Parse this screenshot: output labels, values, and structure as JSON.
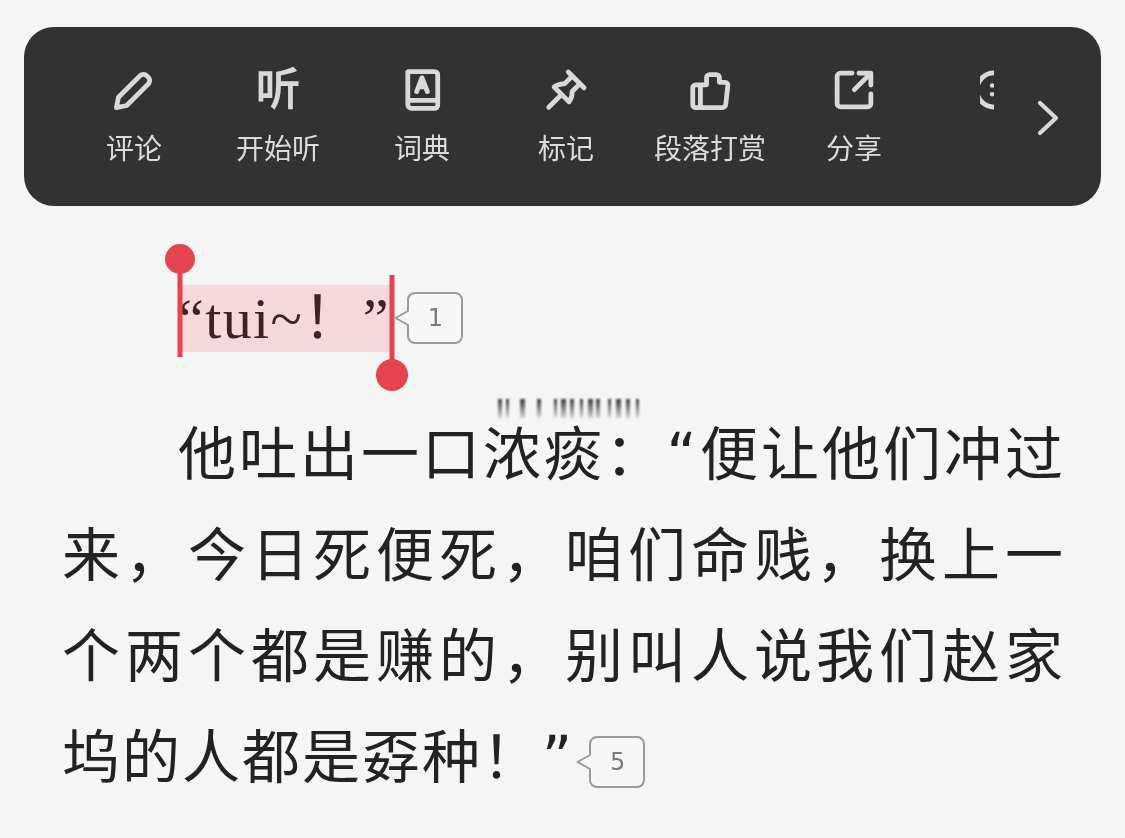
{
  "toolbar": {
    "items": [
      {
        "kind": "icon",
        "label": "评论"
      },
      {
        "kind": "glyph",
        "glyph": "听",
        "label": "开始听"
      },
      {
        "kind": "icon",
        "label": "词典"
      },
      {
        "kind": "icon",
        "label": "标记"
      },
      {
        "kind": "icon",
        "label": "段落打赏"
      },
      {
        "kind": "icon",
        "label": "分享"
      },
      {
        "kind": "partial"
      }
    ]
  },
  "selection": {
    "text": "“tui~！”",
    "badge": "1"
  },
  "paragraph": {
    "text": "他吐出一口浓痰：“便让他们冲过来，今日死便死，咱们命贱，换上一个两个都是赚的，别叫人说我们赵家坞的人都是孬种！”",
    "badge": "5"
  }
}
